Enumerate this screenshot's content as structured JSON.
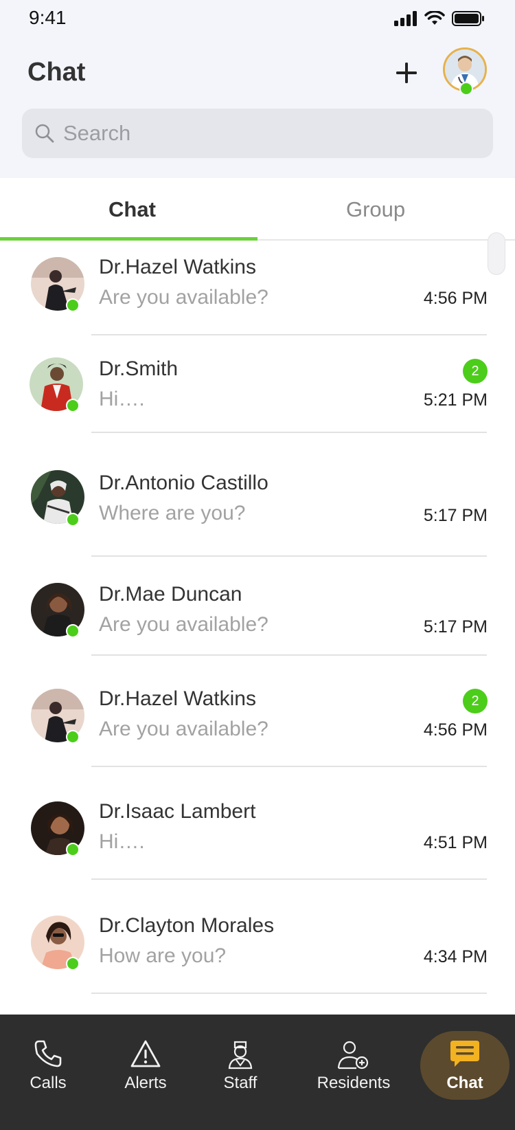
{
  "status_bar": {
    "time": "9:41"
  },
  "header": {
    "title": "Chat",
    "search_placeholder": "Search"
  },
  "tabs": [
    {
      "label": "Chat",
      "active": true
    },
    {
      "label": "Group",
      "active": false
    }
  ],
  "chats": [
    {
      "name": "Dr.Hazel Watkins",
      "preview": "Are you available?",
      "time": "4:56 PM",
      "badge": "",
      "online": true
    },
    {
      "name": "Dr.Smith",
      "preview": "Hi….",
      "time": "5:21 PM",
      "badge": "2",
      "online": true
    },
    {
      "name": "Dr.Antonio Castillo",
      "preview": "Where are you?",
      "time": "5:17 PM",
      "badge": "",
      "online": true
    },
    {
      "name": "Dr.Mae Duncan",
      "preview": "Are you available?",
      "time": "5:17 PM",
      "badge": "",
      "online": true
    },
    {
      "name": "Dr.Hazel Watkins",
      "preview": "Are you available?",
      "time": "4:56 PM",
      "badge": "2",
      "online": true
    },
    {
      "name": "Dr.Isaac Lambert",
      "preview": "Hi….",
      "time": "4:51 PM",
      "badge": "",
      "online": true
    },
    {
      "name": "Dr.Clayton Morales",
      "preview": "How are you?",
      "time": "4:34 PM",
      "badge": "",
      "online": true
    }
  ],
  "bottom_nav": [
    {
      "label": "Calls",
      "icon": "phone-icon",
      "active": false
    },
    {
      "label": "Alerts",
      "icon": "alert-triangle-icon",
      "active": false
    },
    {
      "label": "Staff",
      "icon": "nurse-icon",
      "active": false
    },
    {
      "label": "Residents",
      "icon": "resident-add-icon",
      "active": false
    },
    {
      "label": "Chat",
      "icon": "chat-bubble-icon",
      "active": true
    }
  ],
  "colors": {
    "accent_green": "#4ccd1a",
    "tab_underline": "#6bd13a",
    "nav_background": "#2e2e2e",
    "nav_active": "#5c4a2e",
    "chat_icon": "#f3b21f"
  }
}
